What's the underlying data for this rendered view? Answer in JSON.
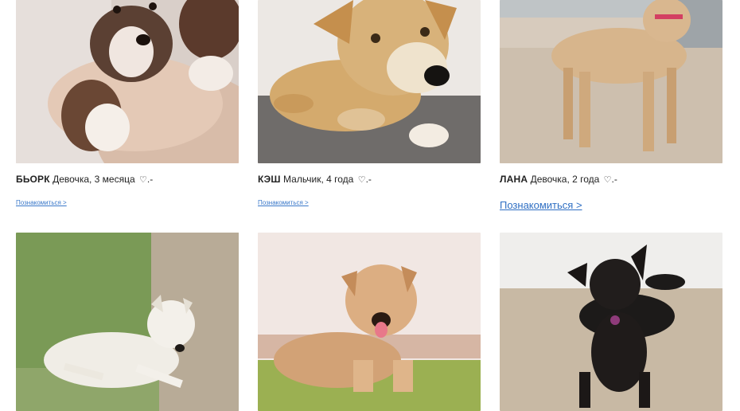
{
  "cards": [
    {
      "name": "БЬОРК",
      "info": "Девочка, 3 месяца",
      "heart": "♡",
      "suffix": ".-",
      "link": "Познакомиться >"
    },
    {
      "name": "КЭШ",
      "info": "Мальчик, 4 года",
      "heart": "♡",
      "suffix": ".-",
      "link": "Познакомиться >"
    },
    {
      "name": "ЛАНА",
      "info": "Девочка, 2 года",
      "heart": "♡",
      "suffix": ".-",
      "link": "Познакомиться >"
    }
  ],
  "colors": {
    "link": "#3a78c9",
    "text": "#222222"
  },
  "icons": {
    "heart": "heart-icon"
  }
}
